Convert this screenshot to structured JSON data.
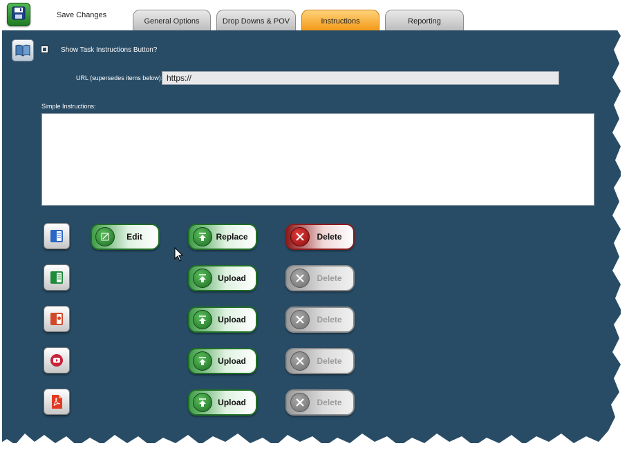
{
  "header": {
    "save_label": "Save Changes",
    "tabs": [
      {
        "label": "General Options",
        "active": false
      },
      {
        "label": "Drop Downs & POV",
        "active": false
      },
      {
        "label": "Instructions",
        "active": true
      },
      {
        "label": "Reporting",
        "active": false
      }
    ]
  },
  "instructions": {
    "show_task_label": "Show Task Instructions Button?",
    "show_task_checked": false,
    "url_label": "URL (supersedes items below):",
    "url_value": "https://",
    "simple_label": "Simple Instructions:",
    "simple_value": ""
  },
  "rows": [
    {
      "icon": "word-document-icon",
      "edit_label": "Edit",
      "upload_label": "Replace",
      "delete_label": "Delete",
      "delete_enabled": true
    },
    {
      "icon": "excel-document-icon",
      "upload_label": "Upload",
      "delete_label": "Delete",
      "delete_enabled": false
    },
    {
      "icon": "powerpoint-document-icon",
      "upload_label": "Upload",
      "delete_label": "Delete",
      "delete_enabled": false
    },
    {
      "icon": "video-play-icon",
      "upload_label": "Upload",
      "delete_label": "Delete",
      "delete_enabled": false
    },
    {
      "icon": "pdf-document-icon",
      "upload_label": "Upload",
      "delete_label": "Delete",
      "delete_enabled": false
    }
  ],
  "colors": {
    "panel": "#284c66",
    "active_tab": "#f39a18",
    "green": "#1f6e26",
    "red": "#8c1b1b"
  }
}
